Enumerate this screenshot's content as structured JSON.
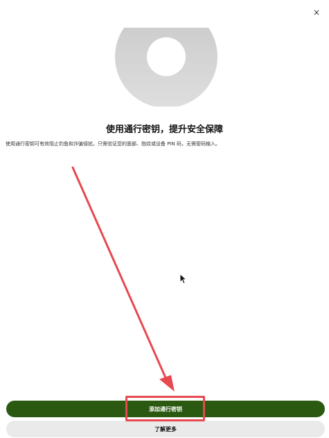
{
  "dialog": {
    "close_label": "×",
    "title": "使用通行密钥，提升安全保障",
    "description": "使用通行密钥可有效阻止钓鱼和诈骗侵扰。只需验证您的面部、指纹或设备 PIN 码，无需密码输入。",
    "primary_button": "添加通行密钥",
    "secondary_button": "了解更多"
  },
  "icons": {
    "close": "close-icon",
    "hero": "passkey-illustration-icon",
    "cursor": "mouse-pointer-icon"
  },
  "colors": {
    "primary": "#2b5912",
    "secondary": "#eaeaea",
    "annotation": "#e8484f",
    "hero": "#d3d3d3"
  }
}
